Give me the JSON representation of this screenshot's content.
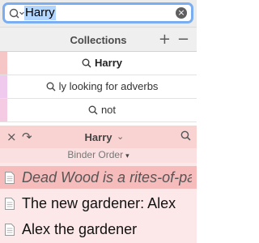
{
  "search": {
    "value": "Harry",
    "clear_icon": "clear-circle-icon"
  },
  "collections": {
    "header": "Collections",
    "add_label": "+",
    "remove_label": "−",
    "items": [
      {
        "label": "Harry",
        "color": "#f6c6c6",
        "bold": true
      },
      {
        "label": "ly looking for adverbs",
        "color": "#efc9ee",
        "bold": false
      },
      {
        "label": "not",
        "color": "#f5cbe4",
        "bold": false
      }
    ]
  },
  "binder": {
    "close_label": "×",
    "redo_label": "↷",
    "title": "Harry",
    "chevron": "⌄",
    "order_label": "Binder Order",
    "order_chevron": "▾",
    "documents": [
      {
        "title": "Dead Wood is a rites-of-passage story",
        "selected": true
      },
      {
        "title": "The new gardener: Alex",
        "selected": false
      },
      {
        "title": "Alex the gardener",
        "selected": false
      }
    ]
  },
  "colors": {
    "accent": "#7aaef0",
    "binder_bg": "#fce8e8",
    "binder_selected": "#f6bcbc"
  }
}
